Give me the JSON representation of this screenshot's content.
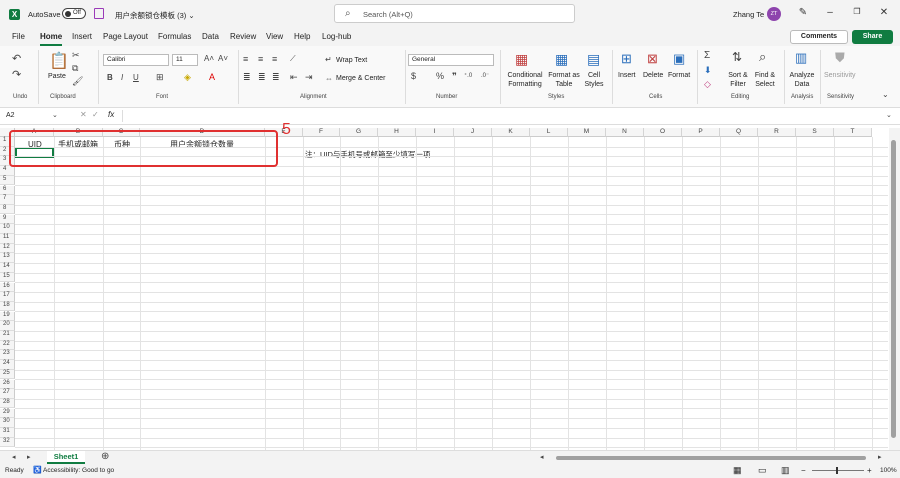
{
  "titlebar": {
    "autosave_label": "AutoSave",
    "autosave_state": "Off",
    "doc_title": "用户余额锁仓模板 (3) ⌄",
    "search_placeholder": "Search (Alt+Q)",
    "user_name": "Zhang Te",
    "avatar_initials": "ZT"
  },
  "menu": {
    "tabs": [
      "File",
      "Home",
      "Insert",
      "Page Layout",
      "Formulas",
      "Data",
      "Review",
      "View",
      "Help",
      "Log-hub"
    ],
    "comments": "Comments",
    "share": "Share"
  },
  "ribbon": {
    "groups": [
      "Undo",
      "Clipboard",
      "Font",
      "Alignment",
      "Number",
      "Styles",
      "Cells",
      "Editing",
      "Analysis",
      "Sensitivity"
    ],
    "paste": "Paste",
    "font_name": "Calibri",
    "font_size": "11",
    "wrap_text": "Wrap Text",
    "merge_center": "Merge & Center",
    "number_format": "General",
    "conditional_formatting": "Conditional Formatting",
    "format_as_table": "Format as Table",
    "cell_styles": "Cell Styles",
    "insert": "Insert",
    "delete": "Delete",
    "format": "Format",
    "sort_filter": "Sort & Filter",
    "find_select": "Find & Select",
    "analyze_data": "Analyze Data",
    "sensitivity": "Sensitivity"
  },
  "formula_bar": {
    "name_box": "A2",
    "fx": "fx"
  },
  "columns": [
    "A",
    "B",
    "C",
    "D",
    "E",
    "F",
    "G",
    "H",
    "I",
    "J",
    "K",
    "L",
    "M",
    "N",
    "O",
    "P",
    "Q",
    "R",
    "S",
    "T"
  ],
  "rows": [
    "1",
    "2",
    "3",
    "4",
    "5",
    "6",
    "7",
    "8",
    "9",
    "10",
    "11",
    "12",
    "13",
    "14",
    "15",
    "16",
    "17",
    "18",
    "19",
    "20",
    "21",
    "22",
    "23",
    "24",
    "25",
    "26",
    "27",
    "28",
    "29",
    "30",
    "31",
    "32"
  ],
  "cells": {
    "a1": "UID",
    "b1": "手机或邮箱",
    "c1": "币种",
    "d1": "用户余额锁仓数量",
    "f2": "注：UID与手机号或邮箱至少填写一项"
  },
  "annotation": "5",
  "sheet": {
    "tab": "Sheet1"
  },
  "status": {
    "ready": "Ready",
    "accessibility": "Accessibility: Good to go",
    "zoom": "100%"
  },
  "colors": {
    "accent": "#107c41",
    "annotation": "#e03030"
  }
}
